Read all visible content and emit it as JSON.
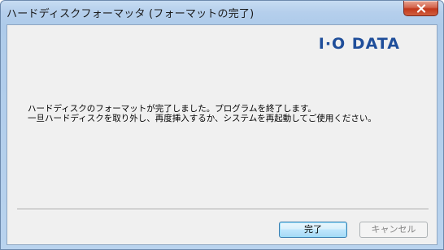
{
  "window": {
    "title": "ハードディスクフォーマッタ (フォーマットの完了)"
  },
  "brand": {
    "logo_text": "I·O DATA",
    "color": "#1f4e9a"
  },
  "message": {
    "line1": "ハードディスクのフォーマットが完了しました。プログラムを終了します。",
    "line2": "一旦ハードディスクを取り外し、再度挿入するか、システムを再起動してご使用ください。"
  },
  "buttons": {
    "ok_label": "完了",
    "cancel_label": "キャンセル"
  },
  "icons": {
    "close": "close-icon"
  }
}
